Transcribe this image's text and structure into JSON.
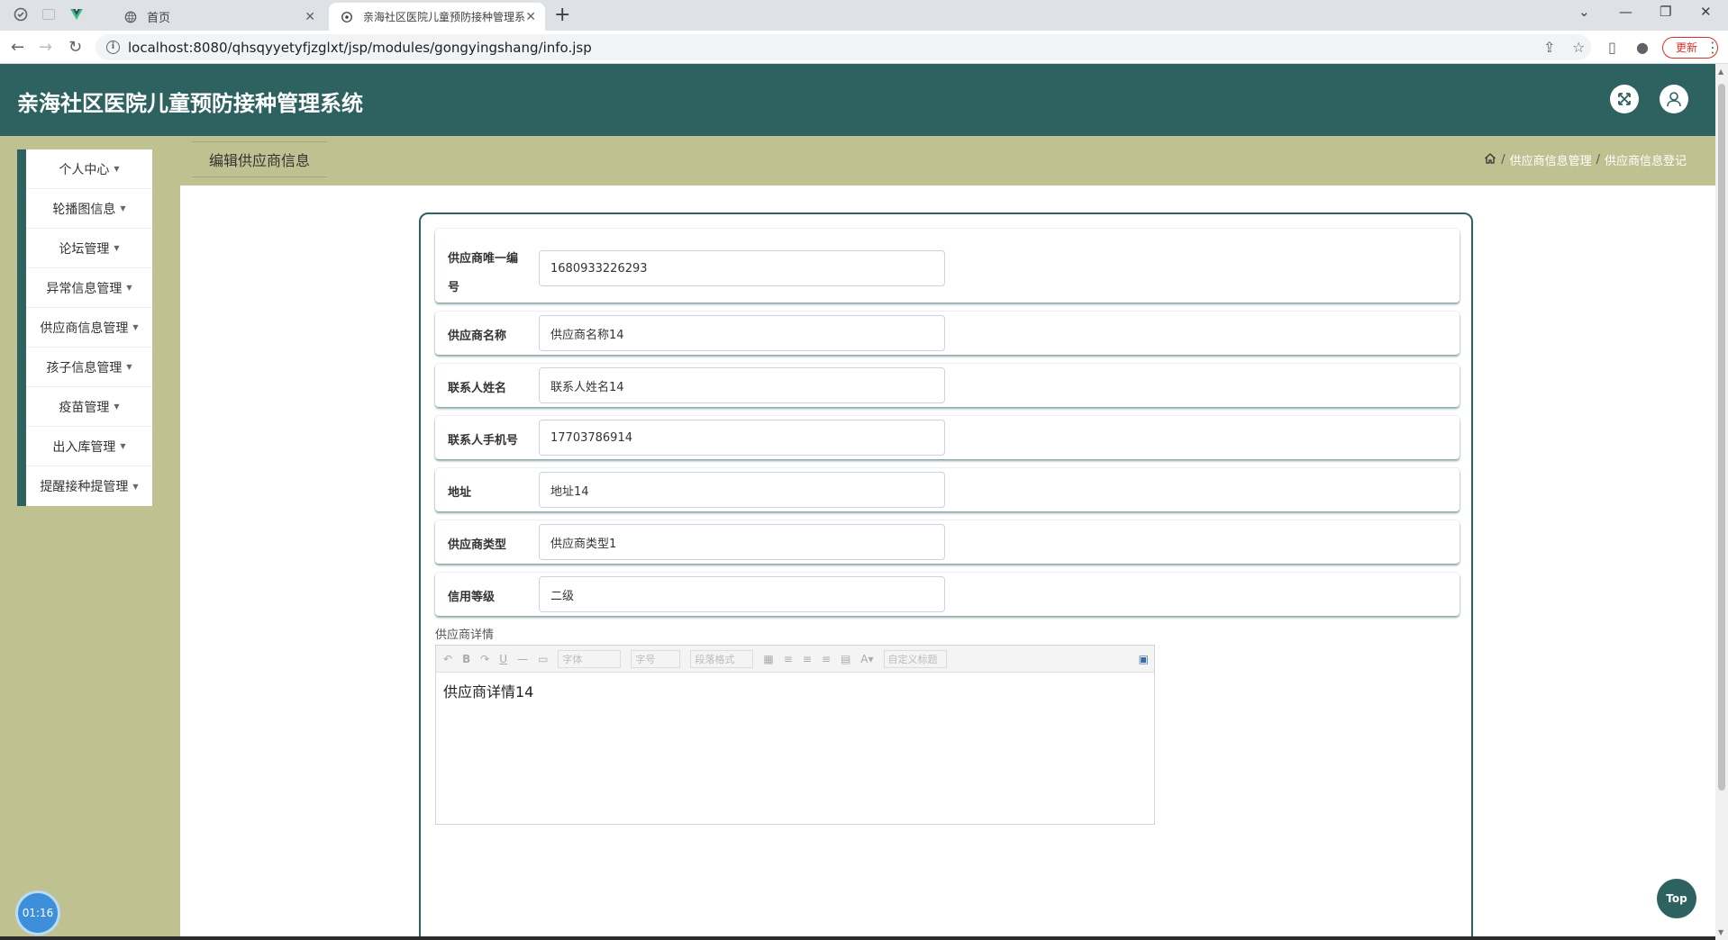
{
  "browser": {
    "tabs": [
      {
        "title": "首页"
      },
      {
        "title": "亲海社区医院儿童预防接种管理系"
      }
    ],
    "url": "localhost:8080/qhsqyyetyfjzglxt/jsp/modules/gongyingshang/info.jsp",
    "update_label": "更新"
  },
  "app": {
    "title": "亲海社区医院儿童预防接种管理系统"
  },
  "sidebar": {
    "items": [
      {
        "label": "个人中心"
      },
      {
        "label": "轮播图信息"
      },
      {
        "label": "论坛管理"
      },
      {
        "label": "异常信息管理"
      },
      {
        "label": "供应商信息管理"
      },
      {
        "label": "孩子信息管理"
      },
      {
        "label": "疫苗管理"
      },
      {
        "label": "出入库管理"
      },
      {
        "label": "提醒接种提管理"
      }
    ]
  },
  "page": {
    "tab_title": "编辑供应商信息",
    "breadcrumb": [
      "供应商信息管理",
      "供应商信息登记"
    ]
  },
  "form": {
    "fields": [
      {
        "label_line1": "供应商唯一编",
        "label_line2": "号",
        "value": "1680933226293"
      },
      {
        "label": "供应商名称",
        "value": "供应商名称14"
      },
      {
        "label": "联系人姓名",
        "value": "联系人姓名14"
      },
      {
        "label": "联系人手机号",
        "value": "17703786914"
      },
      {
        "label": "地址",
        "value": "地址14"
      },
      {
        "label": "供应商类型",
        "value": "供应商类型1"
      },
      {
        "label": "信用等级",
        "value": "二级"
      }
    ],
    "details_label": "供应商详情",
    "editor": {
      "font_placeholder": "字体",
      "size_placeholder": "字号",
      "paragraph_placeholder": "段落格式",
      "custom_title_placeholder": "自定义标题",
      "content": "供应商详情14"
    }
  },
  "widgets": {
    "timer": "01:16",
    "top_label": "Top"
  }
}
